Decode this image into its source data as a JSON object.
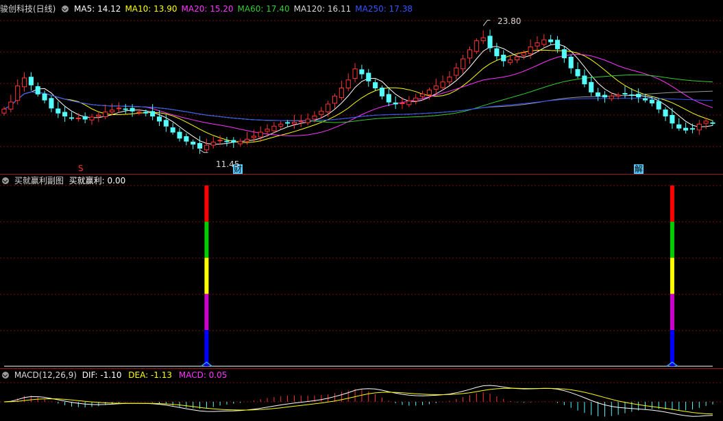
{
  "main_header": {
    "title": "骏创科技(日线)",
    "ma": [
      {
        "label": "MA5: 14.12",
        "color": "#ffffff"
      },
      {
        "label": "MA10: 13.90",
        "color": "#ffff00"
      },
      {
        "label": "MA20: 15.20",
        "color": "#ff33ff"
      },
      {
        "label": "MA60: 17.40",
        "color": "#33cc33"
      },
      {
        "label": "MA120: 16.11",
        "color": "#d8d8d8"
      },
      {
        "label": "MA250: 17.38",
        "color": "#3355ff"
      }
    ]
  },
  "annotations": {
    "high_label": "23.80",
    "low_label": "11.45",
    "markers": [
      "S",
      "财",
      "解"
    ]
  },
  "sub_header": {
    "name": "买就赢利副图",
    "value_label": "买就赢利: 0.00"
  },
  "macd_header": {
    "name": "MACD(12,26,9)",
    "dif": "DIF: -1.10",
    "dea": "DEA: -1.13",
    "macd": "MACD: 0.05"
  },
  "colors": {
    "up": "#ff3333",
    "down": "#54fcfc",
    "grid": "#7a1010",
    "separator": "#a01818",
    "signal_bar": [
      "#ff0000",
      "#00cc00",
      "#ffff00",
      "#cc00cc",
      "#0000ff"
    ]
  },
  "chart_data": [
    {
      "type": "candlestick",
      "ylim": [
        10,
        25
      ],
      "high": 23.8,
      "low": 11.45,
      "closes": [
        15.5,
        16.2,
        17.8,
        18.6,
        17.9,
        17.0,
        16.4,
        15.6,
        15.1,
        14.8,
        14.6,
        14.6,
        14.5,
        14.7,
        14.9,
        15.2,
        15.4,
        15.6,
        15.5,
        15.3,
        15.2,
        15.1,
        14.8,
        14.3,
        13.8,
        13.2,
        12.6,
        12.3,
        12.0,
        11.6,
        11.9,
        12.2,
        12.4,
        12.3,
        12.2,
        12.3,
        12.5,
        12.8,
        13.2,
        13.5,
        13.8,
        14.0,
        14.1,
        14.2,
        14.3,
        14.5,
        14.8,
        15.3,
        16.0,
        16.8,
        17.6,
        18.4,
        19.5,
        19.0,
        18.3,
        17.6,
        16.8,
        16.2,
        16.0,
        16.1,
        16.3,
        16.6,
        17.0,
        17.4,
        17.8,
        18.2,
        18.7,
        19.6,
        20.5,
        21.4,
        22.3,
        22.6,
        21.6,
        20.8,
        20.3,
        20.4,
        20.7,
        21.1,
        21.7,
        22.1,
        22.4,
        22.2,
        21.5,
        20.6,
        19.6,
        18.8,
        18.0,
        17.2,
        16.8,
        16.7,
        16.8,
        16.9,
        17.0,
        16.9,
        16.7,
        16.4,
        16.1,
        15.5,
        14.8,
        14.1,
        13.6,
        13.4,
        13.5,
        14.0,
        14.3,
        14.1
      ]
    },
    {
      "type": "bar",
      "series": [
        {
          "name": "买就赢利",
          "values": [
            0,
            0,
            0,
            0,
            0,
            0,
            0,
            0,
            0,
            0,
            0,
            0,
            0,
            0,
            0,
            0,
            0,
            0,
            0,
            0,
            0,
            0,
            0,
            0,
            0,
            0,
            0,
            0,
            0,
            0,
            1,
            0,
            0,
            0,
            0,
            0,
            0,
            0,
            0,
            0,
            0,
            0,
            0,
            0,
            0,
            0,
            0,
            0,
            0,
            0,
            0,
            0,
            0,
            0,
            0,
            0,
            0,
            0,
            0,
            0,
            0,
            0,
            0,
            0,
            0,
            0,
            0,
            0,
            0,
            0,
            0,
            0,
            0,
            0,
            0,
            0,
            0,
            0,
            0,
            0,
            0,
            0,
            0,
            0,
            0,
            0,
            0,
            0,
            0,
            0,
            0,
            0,
            0,
            0,
            0,
            0,
            0,
            0,
            0,
            1,
            0,
            0,
            0,
            0,
            0,
            0
          ]
        }
      ],
      "ylim": [
        0,
        1
      ]
    },
    {
      "type": "macd",
      "dif": -1.1,
      "dea": -1.13,
      "macd": 0.05
    }
  ]
}
